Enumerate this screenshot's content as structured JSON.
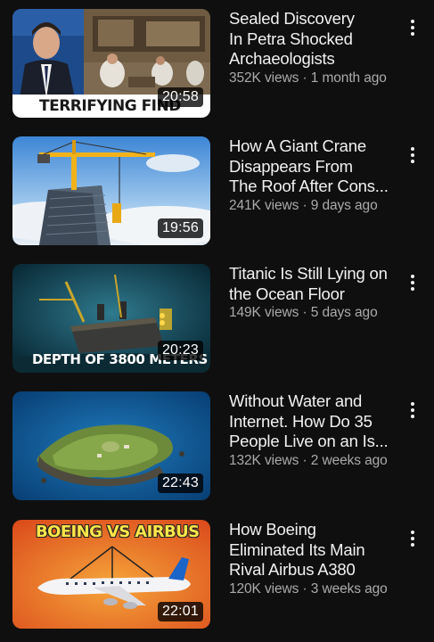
{
  "videos": [
    {
      "title_lines": [
        "Sealed Discovery",
        "In Petra Shocked",
        "Archaeologists"
      ],
      "views": "352K views",
      "age": "1 month ago",
      "duration": "20:58",
      "thumb_caption": "TERRIFYING FIND"
    },
    {
      "title_lines": [
        "How A Giant Crane",
        "Disappears From",
        "The Roof After Cons..."
      ],
      "views": "241K views",
      "age": "9 days ago",
      "duration": "19:56"
    },
    {
      "title_lines": [
        "Titanic Is Still Lying on",
        "the Ocean Floor"
      ],
      "views": "149K views",
      "age": "5 days ago",
      "duration": "20:23",
      "thumb_caption": "DEPTH OF 3800 METERS"
    },
    {
      "title_lines": [
        "Without Water and",
        "Internet. How Do 35",
        "People Live on an Is..."
      ],
      "views": "132K views",
      "age": "2 weeks ago",
      "duration": "22:43"
    },
    {
      "title_lines": [
        "How Boeing",
        "Eliminated Its Main",
        "Rival Airbus A380"
      ],
      "views": "120K views",
      "age": "3 weeks ago",
      "duration": "22:01",
      "thumb_caption": "BOEING VS AIRBUS"
    }
  ],
  "meta_separator": " · "
}
